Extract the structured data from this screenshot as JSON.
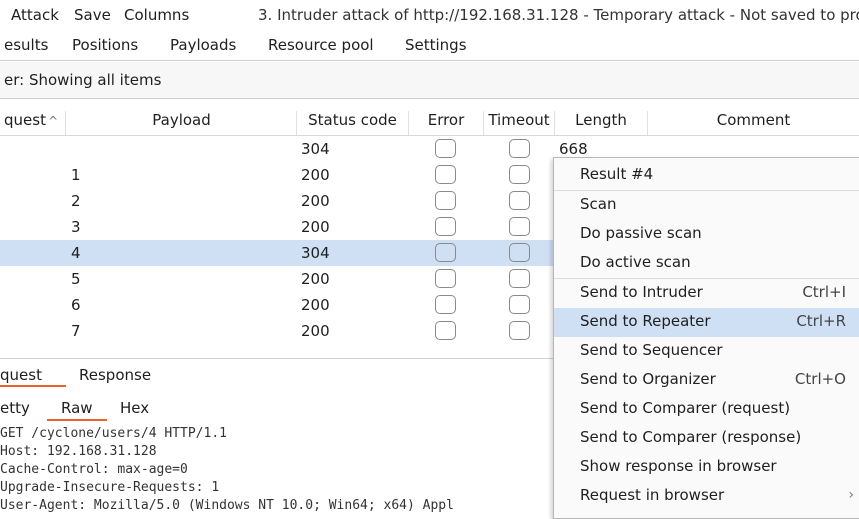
{
  "menubar": {
    "items": [
      "Attack",
      "Save",
      "Columns"
    ],
    "window_title": "3. Intruder attack of http://192.168.31.128 - Temporary attack - Not saved to pro"
  },
  "tabs": [
    "esults",
    "Positions",
    "Payloads",
    "Resource pool",
    "Settings"
  ],
  "filter": {
    "text": "er: Showing all items"
  },
  "table": {
    "columns": [
      "quest",
      "Payload",
      "Status code",
      "Error",
      "Timeout",
      "Length",
      "Comment"
    ],
    "sort_glyph": "^",
    "rows": [
      {
        "payload": "",
        "status": "304",
        "length": "668"
      },
      {
        "payload": "1",
        "status": "200",
        "length": ""
      },
      {
        "payload": "2",
        "status": "200",
        "length": ""
      },
      {
        "payload": "3",
        "status": "200",
        "length": ""
      },
      {
        "payload": "4",
        "status": "304",
        "length": ""
      },
      {
        "payload": "5",
        "status": "200",
        "length": ""
      },
      {
        "payload": "6",
        "status": "200",
        "length": ""
      },
      {
        "payload": "7",
        "status": "200",
        "length": ""
      }
    ],
    "selected_row": 4
  },
  "req_tabs": [
    "quest",
    "Response"
  ],
  "view_tabs": [
    "etty",
    "Raw",
    "Hex"
  ],
  "request_lines": [
    "GET /cyclone/users/4 HTTP/1.1",
    "Host: 192.168.31.128",
    "Cache-Control: max-age=0",
    "Upgrade-Insecure-Requests: 1",
    "User-Agent: Mozilla/5.0 (Windows NT 10.0; Win64; x64) Appl"
  ],
  "context_menu": {
    "header": "Result #4",
    "items": [
      {
        "label": "Scan",
        "shortcut": ""
      },
      {
        "label": "Do passive scan",
        "shortcut": ""
      },
      {
        "label": "Do active scan",
        "shortcut": ""
      },
      {
        "label": "Send to Intruder",
        "shortcut": "Ctrl+I"
      },
      {
        "label": "Send to Repeater",
        "shortcut": "Ctrl+R"
      },
      {
        "label": "Send to Sequencer",
        "shortcut": ""
      },
      {
        "label": "Send to Organizer",
        "shortcut": "Ctrl+O"
      },
      {
        "label": "Send to Comparer (request)",
        "shortcut": ""
      },
      {
        "label": "Send to Comparer (response)",
        "shortcut": ""
      },
      {
        "label": "Show response in browser",
        "shortcut": ""
      },
      {
        "label": "Request in browser",
        "shortcut": ""
      }
    ],
    "submenu_arrow": "›"
  },
  "colors": {
    "accent": "#e8642c",
    "selection": "#cfe0f5"
  }
}
